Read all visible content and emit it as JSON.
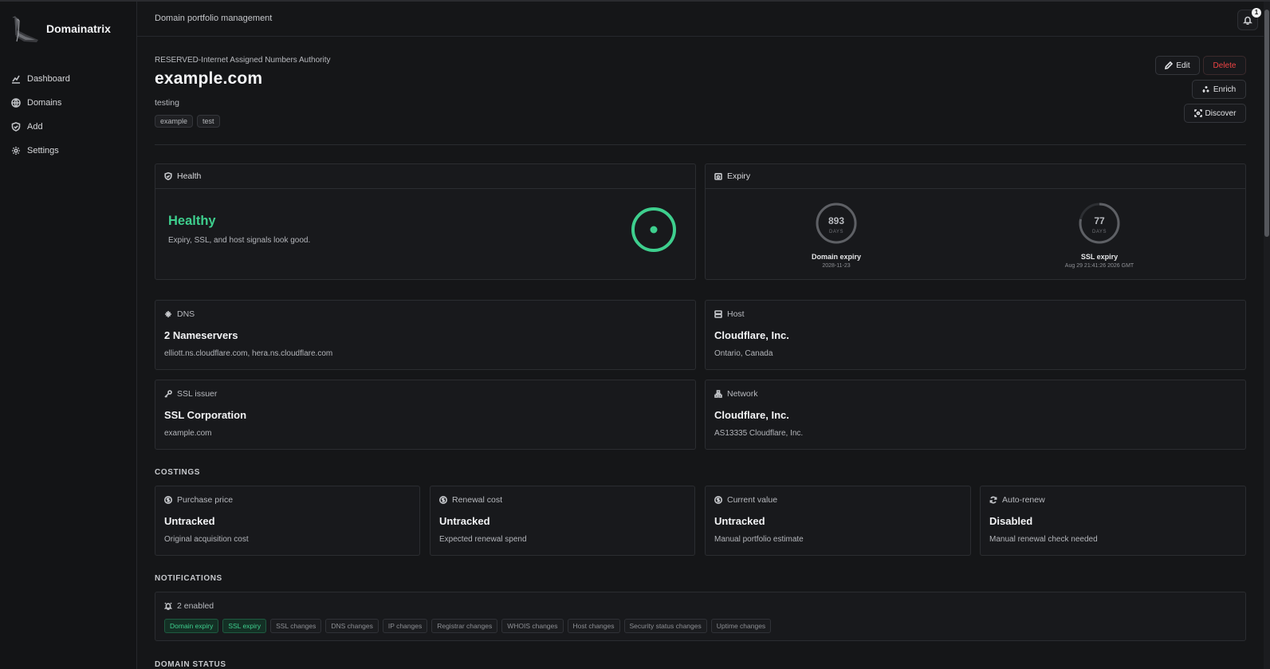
{
  "app": {
    "name": "Domainatrix"
  },
  "sidebar": {
    "items": [
      {
        "label": "Dashboard",
        "icon": "chart-icon"
      },
      {
        "label": "Domains",
        "icon": "globe-icon"
      },
      {
        "label": "Add",
        "icon": "shield-icon"
      },
      {
        "label": "Settings",
        "icon": "gear-icon"
      }
    ]
  },
  "header": {
    "title": "Domain portfolio management",
    "notification_count": "1"
  },
  "domain": {
    "registrar": "RESERVED-Internet Assigned Numbers Authority",
    "name": "example.com",
    "description": "testing",
    "tags": [
      "example",
      "test"
    ]
  },
  "actions": {
    "edit": "Edit",
    "delete": "Delete",
    "enrich": "Enrich",
    "discover": "Discover"
  },
  "health": {
    "title": "Health",
    "status": "Healthy",
    "summary": "Expiry, SSL, and host signals look good.",
    "status_color": "#3ecf8e"
  },
  "expiry": {
    "title": "Expiry",
    "domain": {
      "days": "893",
      "unit": "DAYS",
      "label": "Domain expiry",
      "date": "2028-11-23"
    },
    "ssl": {
      "days": "77",
      "unit": "DAYS",
      "label": "SSL expiry",
      "date": "Aug 29 21:41:26 2026 GMT"
    }
  },
  "dns": {
    "title": "DNS",
    "value": "2 Nameservers",
    "detail": "elliott.ns.cloudflare.com, hera.ns.cloudflare.com"
  },
  "host": {
    "title": "Host",
    "value": "Cloudflare, Inc.",
    "detail": "Ontario, Canada"
  },
  "ssl_issuer": {
    "title": "SSL issuer",
    "value": "SSL Corporation",
    "detail": "example.com"
  },
  "network": {
    "title": "Network",
    "value": "Cloudflare, Inc.",
    "detail": "AS13335 Cloudflare, Inc."
  },
  "costings": {
    "title": "COSTINGS",
    "cards": [
      {
        "title": "Purchase price",
        "value": "Untracked",
        "detail": "Original acquisition cost",
        "icon": "dollar-icon"
      },
      {
        "title": "Renewal cost",
        "value": "Untracked",
        "detail": "Expected renewal spend",
        "icon": "dollar-icon"
      },
      {
        "title": "Current value",
        "value": "Untracked",
        "detail": "Manual portfolio estimate",
        "icon": "dollar-icon"
      },
      {
        "title": "Auto-renew",
        "value": "Disabled",
        "detail": "Manual renewal check needed",
        "icon": "refresh-icon"
      }
    ]
  },
  "notifications": {
    "title": "NOTIFICATIONS",
    "summary": "2 enabled",
    "tags": [
      {
        "label": "Domain expiry",
        "enabled": true
      },
      {
        "label": "SSL expiry",
        "enabled": true
      },
      {
        "label": "SSL changes",
        "enabled": false
      },
      {
        "label": "DNS changes",
        "enabled": false
      },
      {
        "label": "IP changes",
        "enabled": false
      },
      {
        "label": "Registrar changes",
        "enabled": false
      },
      {
        "label": "WHOIS changes",
        "enabled": false
      },
      {
        "label": "Host changes",
        "enabled": false
      },
      {
        "label": "Security status changes",
        "enabled": false
      },
      {
        "label": "Uptime changes",
        "enabled": false
      }
    ]
  },
  "domain_status": {
    "title": "DOMAIN STATUS"
  }
}
